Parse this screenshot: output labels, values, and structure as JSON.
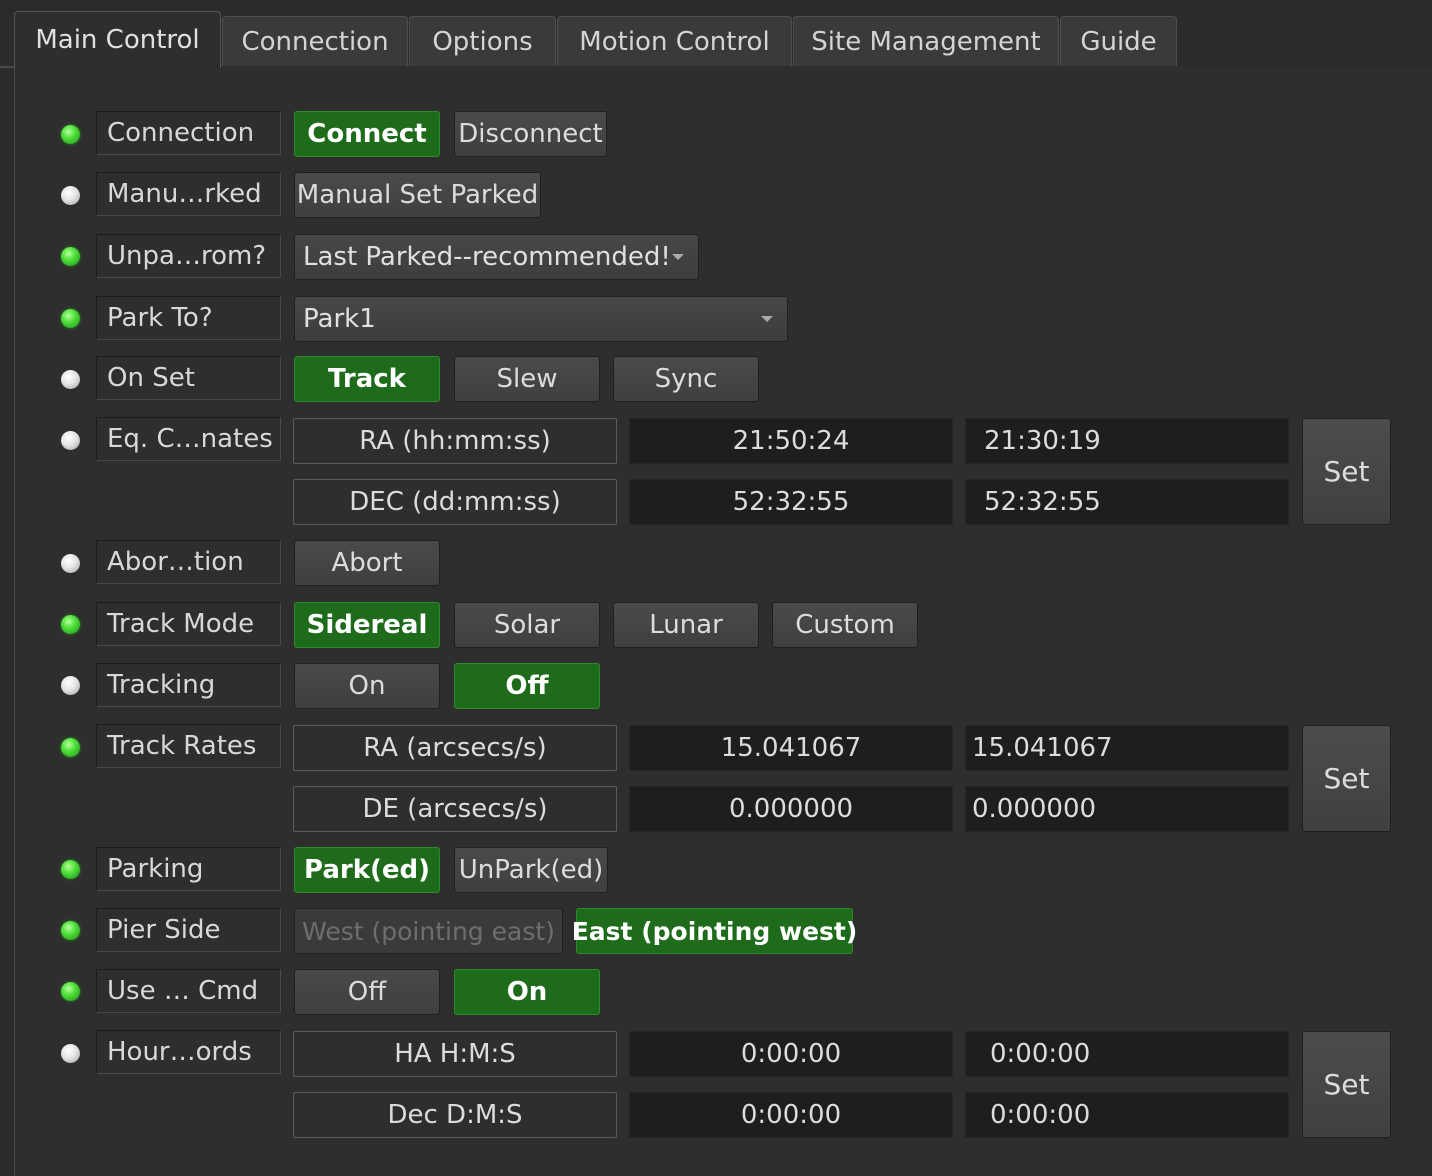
{
  "tabs": [
    "Main Control",
    "Connection",
    "Options",
    "Motion Control",
    "Site Management",
    "Guide"
  ],
  "rows": {
    "connection": {
      "label": "Connection",
      "connect": "Connect",
      "disconnect": "Disconnect",
      "led": "green"
    },
    "manual_parked": {
      "label": "Manu…rked",
      "button": "Manual Set Parked",
      "led": "white"
    },
    "unpark_from": {
      "label": "Unpa…rom?",
      "value": "Last Parked--recommended!",
      "led": "green"
    },
    "park_to": {
      "label": "Park To?",
      "value": "Park1",
      "led": "green"
    },
    "on_set": {
      "label": "On Set",
      "track": "Track",
      "slew": "Slew",
      "sync": "Sync",
      "led": "white"
    },
    "eq_coords": {
      "label": "Eq. C…nates",
      "led": "white",
      "ra_label": "RA (hh:mm:ss)",
      "ra_current": "21:50:24",
      "ra_target": "21:30:19",
      "dec_label": "DEC (dd:mm:ss)",
      "dec_current": "52:32:55",
      "dec_target": "52:32:55",
      "set": "Set"
    },
    "abort": {
      "label": "Abor…tion",
      "button": "Abort",
      "led": "white"
    },
    "track_mode": {
      "label": "Track Mode",
      "sidereal": "Sidereal",
      "solar": "Solar",
      "lunar": "Lunar",
      "custom": "Custom",
      "led": "green"
    },
    "tracking": {
      "label": "Tracking",
      "on": "On",
      "off": "Off",
      "led": "white"
    },
    "track_rates": {
      "label": "Track Rates",
      "led": "green",
      "ra_label": "RA (arcsecs/s)",
      "ra_current": "15.041067",
      "ra_target": "15.041067",
      "de_label": "DE (arcsecs/s)",
      "de_current": "0.000000",
      "de_target": "0.000000",
      "set": "Set"
    },
    "parking": {
      "label": "Parking",
      "park": "Park(ed)",
      "unpark": "UnPark(ed)",
      "led": "green"
    },
    "pier_side": {
      "label": "Pier Side",
      "west": "West (pointing east)",
      "east": "East (pointing west)",
      "led": "green"
    },
    "use_cmd": {
      "label": "Use … Cmd",
      "off": "Off",
      "on": "On",
      "led": "green"
    },
    "hour_coords": {
      "label": "Hour…ords",
      "led": "white",
      "ha_label": "HA H:M:S",
      "ha_current": "0:00:00",
      "ha_target": "0:00:00",
      "dec_label": "Dec D:M:S",
      "dec_current": "0:00:00",
      "dec_target": "0:00:00",
      "set": "Set"
    }
  }
}
